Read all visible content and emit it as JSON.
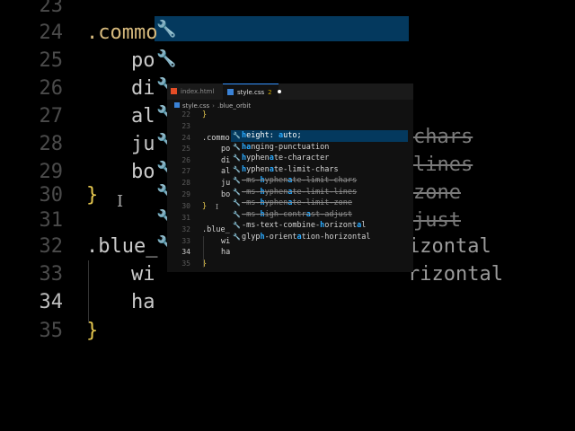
{
  "background": {
    "line_numbers": [
      "23",
      "24",
      "25",
      "26",
      "27",
      "28",
      "29",
      "30",
      "31",
      "32",
      "33",
      "34",
      "35"
    ],
    "current_line": "34",
    "code_lines": [
      ".commo",
      "po",
      "di",
      "al",
      "ju",
      "bo",
      "}",
      ".blue_",
      "wi",
      "ha",
      "}"
    ],
    "suggestion_fragments": [
      "chars",
      "lines",
      "zone",
      "just",
      "izontal",
      "rizontal"
    ]
  },
  "tabs": [
    {
      "label": "index.html"
    },
    {
      "label": "style.css",
      "badge": "2"
    }
  ],
  "breadcrumb": {
    "file": "style.css",
    "selector": ".blue_orbit"
  },
  "editor": {
    "line_numbers": [
      "22",
      "23",
      "24",
      "25",
      "26",
      "27",
      "28",
      "29",
      "30",
      "31",
      "32",
      "33",
      "34",
      "35"
    ],
    "current_line": "34",
    "lines": [
      "}",
      "",
      ".commo",
      "po",
      "di",
      "al",
      "ju",
      "bo",
      "}",
      "",
      ".blue_",
      "wi",
      "ha",
      "}"
    ]
  },
  "suggestions": [
    {
      "label": "height: auto;",
      "selected": true,
      "deprecated": false
    },
    {
      "label": "hanging-punctuation",
      "selected": false,
      "deprecated": false
    },
    {
      "label": "hyphenate-character",
      "selected": false,
      "deprecated": false
    },
    {
      "label": "hyphenate-limit-chars",
      "selected": false,
      "deprecated": false
    },
    {
      "label": "-ms-hyphenate-limit-chars",
      "selected": false,
      "deprecated": true
    },
    {
      "label": "-ms-hyphenate-limit-lines",
      "selected": false,
      "deprecated": true
    },
    {
      "label": "-ms-hyphenate-limit-zone",
      "selected": false,
      "deprecated": true
    },
    {
      "label": "-ms-high-contrast-adjust",
      "selected": false,
      "deprecated": true
    },
    {
      "label": "-ms-text-combine-horizontal",
      "selected": false,
      "deprecated": false
    },
    {
      "label": "glyph-orientation-horizontal",
      "selected": false,
      "deprecated": false
    }
  ],
  "colors": {
    "accent": "#3794ff",
    "selection": "#04395e",
    "match": "#2aaaff",
    "brace": "#e6c84f"
  }
}
